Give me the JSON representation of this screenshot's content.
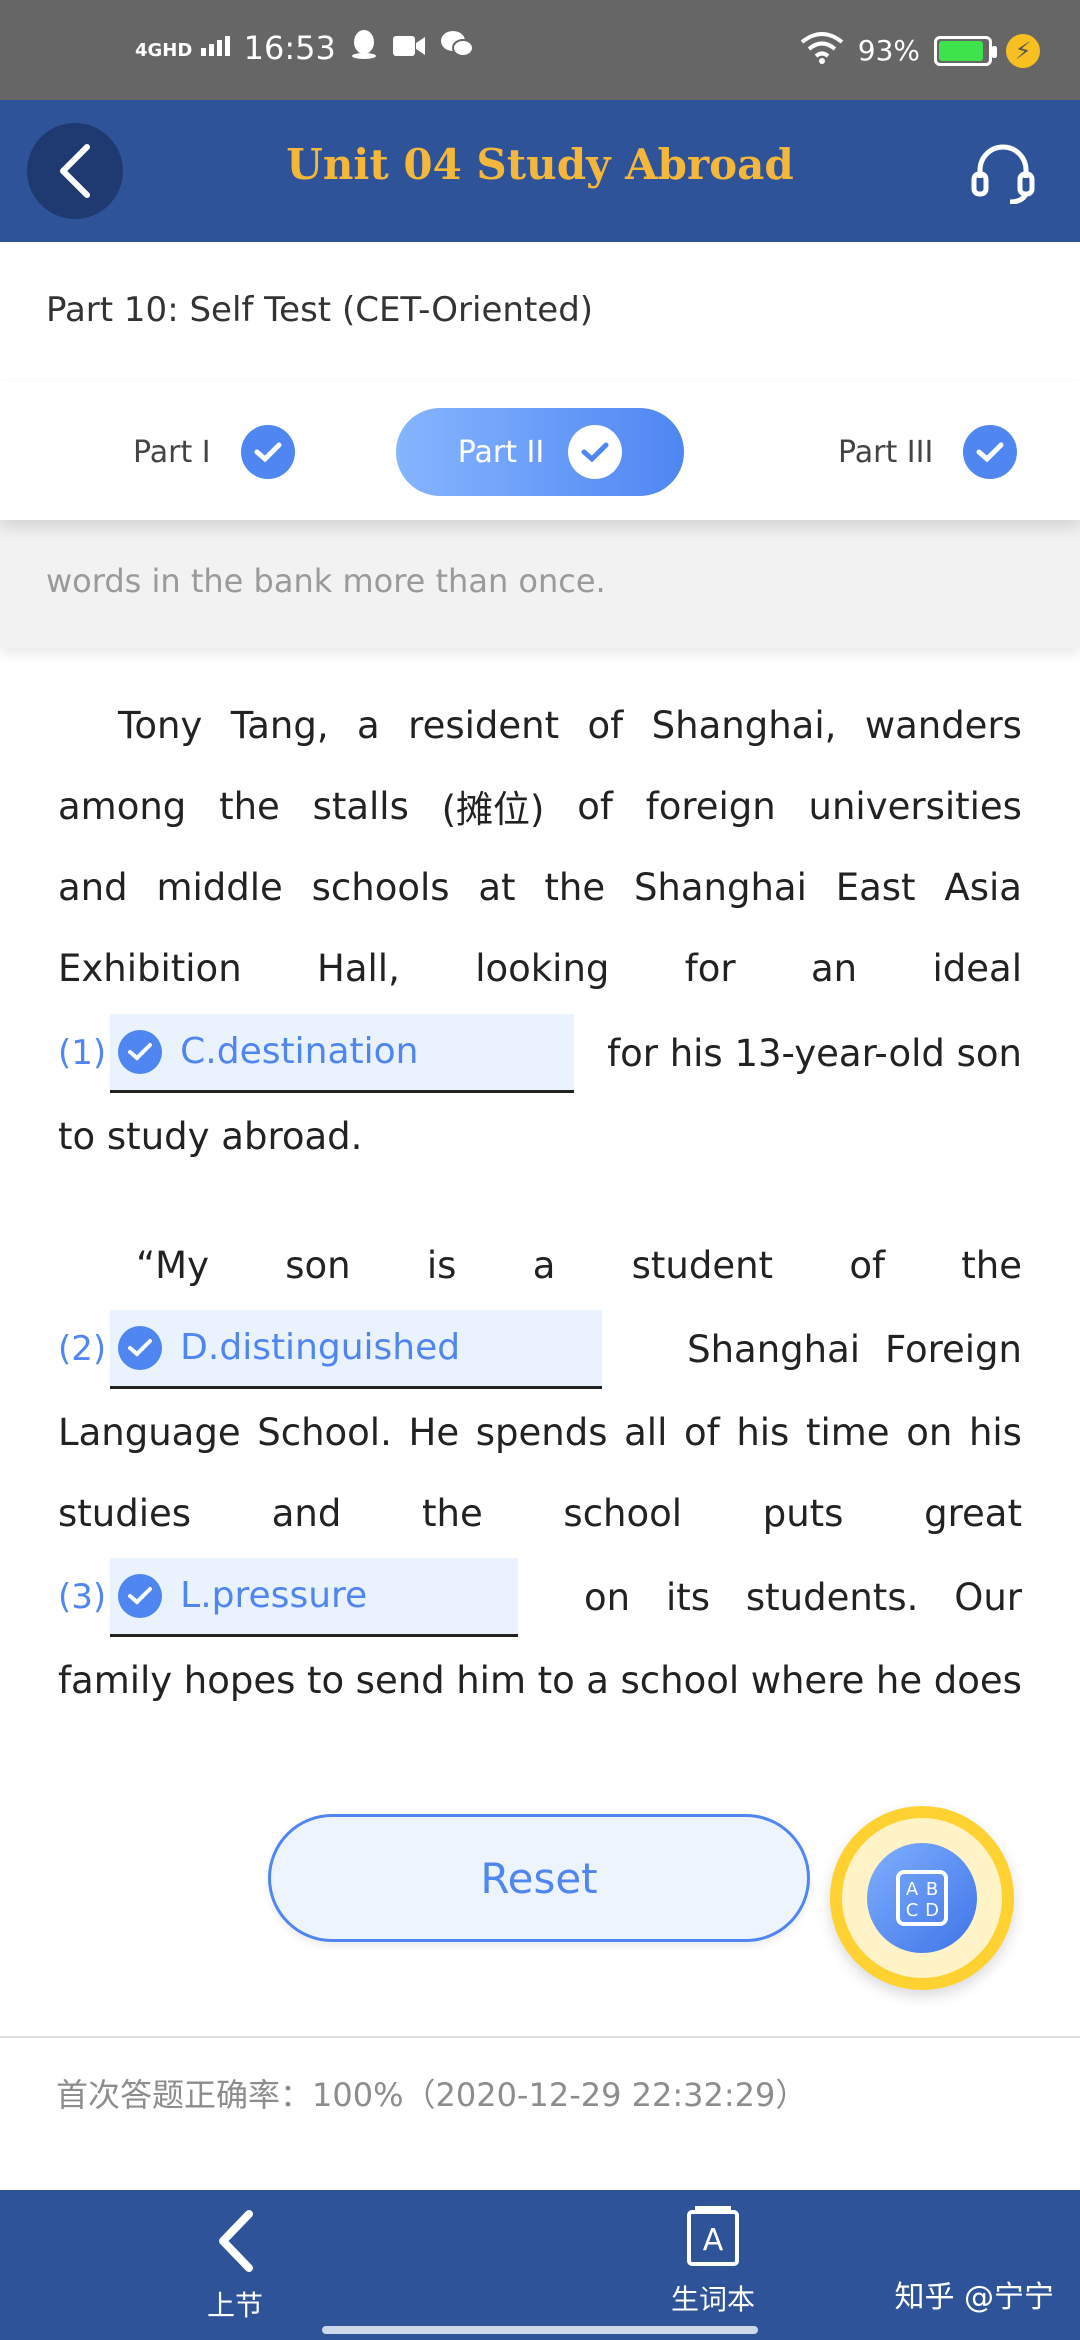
{
  "status_bar": {
    "network": "4GHD",
    "time": "16:53",
    "battery": "93%"
  },
  "header": {
    "title": "Unit 04 Study Abroad"
  },
  "part_title": "Part 10: Self Test (CET-Oriented)",
  "tabs": [
    {
      "label": "Part I",
      "active": false
    },
    {
      "label": "Part II",
      "active": true
    },
    {
      "label": "Part III",
      "active": false
    }
  ],
  "instruction": "words in the bank more than once.",
  "passage": {
    "p1": {
      "l1": [
        "Tony",
        "Tang,",
        "a",
        "resident",
        "of",
        "Shanghai,",
        "wanders"
      ],
      "l2": [
        "among",
        "the",
        "stalls",
        "(摊位)",
        "of",
        "foreign",
        "universities"
      ],
      "l3": [
        "and",
        "middle",
        "schools",
        "at",
        "the",
        "Shanghai",
        "East",
        "Asia"
      ],
      "l4": [
        "Exhibition",
        "Hall,",
        "looking",
        "for",
        "an",
        "ideal"
      ],
      "l5_after": "for his 13-year-old son",
      "l6": "to study abroad."
    },
    "p2": {
      "l1": [
        "“My",
        "son",
        "is",
        "a",
        "student",
        "of",
        "the"
      ],
      "l2_after": [
        "Shanghai",
        "Foreign"
      ],
      "l3": [
        "Language",
        "School.",
        "He",
        "spends",
        "all",
        "of",
        "his",
        "time",
        "on",
        "his"
      ],
      "l4": [
        "studies",
        "and",
        "the",
        "school",
        "puts",
        "great"
      ],
      "l5_after": [
        "on",
        "its",
        "students.",
        "Our"
      ],
      "l6": [
        "family",
        "hopes",
        "to",
        "send",
        "him",
        "to",
        "a",
        "school",
        "where",
        "he",
        "does"
      ]
    },
    "blanks": [
      {
        "num": "(1)",
        "answer": "C.destination"
      },
      {
        "num": "(2)",
        "answer": "D.distinguished"
      },
      {
        "num": "(3)",
        "answer": "L.pressure"
      }
    ]
  },
  "reset_label": "Reset",
  "fab_letters": [
    "A",
    "B",
    "C",
    "D"
  ],
  "accuracy": "首次答题正确率：100%（2020-12-29 22:32:29）",
  "bottom_nav": {
    "prev_label": "上节",
    "words_label": "生词本",
    "watermark": "知乎 @宁宁"
  },
  "colors": {
    "header": "#2f5399",
    "accent": "#4f86f2",
    "title": "#f5b73a",
    "fab": "#ffd231"
  }
}
